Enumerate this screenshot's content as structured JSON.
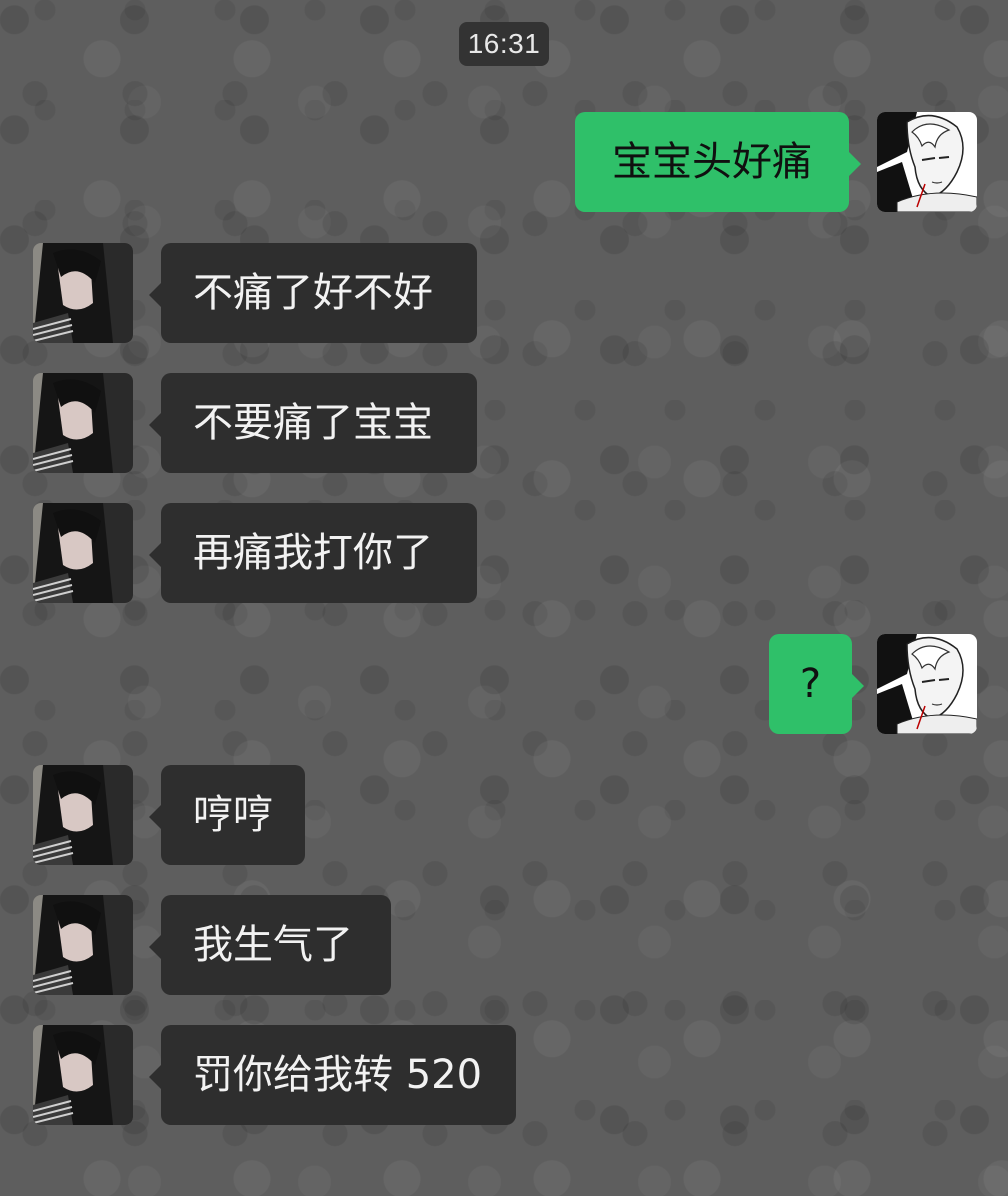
{
  "header": {
    "time": "16:31"
  },
  "messages": [
    {
      "side": "right",
      "text": "宝宝头好痛"
    },
    {
      "side": "left",
      "text": "不痛了好不好"
    },
    {
      "side": "left",
      "text": "不要痛了宝宝"
    },
    {
      "side": "left",
      "text": "再痛我打你了"
    },
    {
      "side": "right",
      "text": "?"
    },
    {
      "side": "left",
      "text": "哼哼"
    },
    {
      "side": "left",
      "text": "我生气了"
    },
    {
      "side": "left",
      "text": "罚你给我转 520"
    }
  ],
  "colors": {
    "background": "#5e5e5e",
    "bubble_left": "#2e2e2e",
    "bubble_right": "#2fc069",
    "time_pill": "#333333"
  },
  "icons": {
    "contact_avatar": "long-hair-person-avatar-icon",
    "self_avatar": "anime-character-avatar-icon"
  }
}
